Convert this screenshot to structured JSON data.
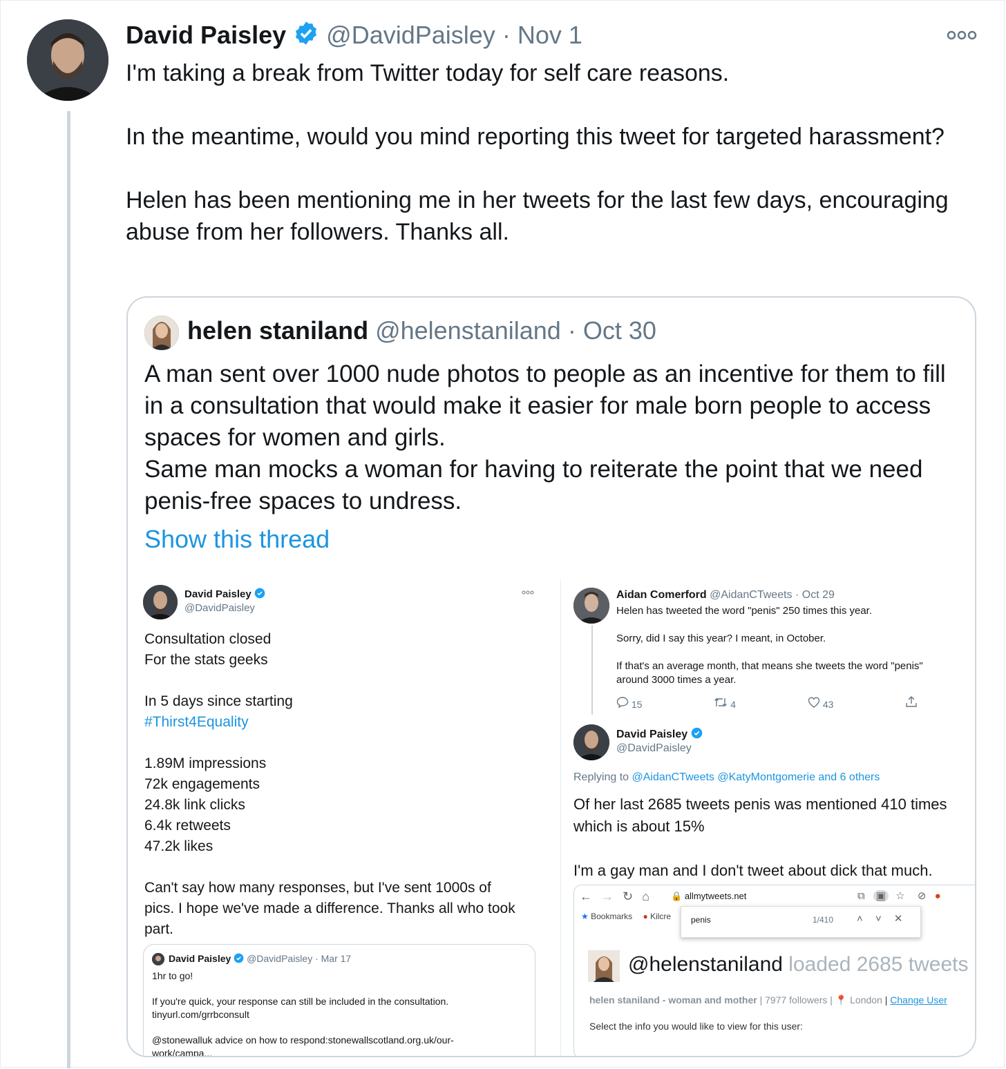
{
  "main_tweet": {
    "author_name": "David Paisley",
    "handle": "@DavidPaisley",
    "separator": "·",
    "date": "Nov 1",
    "text": "I'm taking a break from Twitter today for self care reasons.\n\nIn the meantime, would you mind reporting this tweet for targeted harassment?\n\nHelen has been mentioning me in her tweets for the last few days, encouraging abuse from her followers. Thanks all.",
    "more_icon": "more-horizontal-icon"
  },
  "quoted_tweet": {
    "author_name": "helen staniland",
    "handle": "@helenstaniland",
    "separator": "·",
    "date": "Oct 30",
    "text": "A man sent over 1000 nude photos to people as an incentive for them to fill in a consultation that would make it easier for male born people to access spaces for women and girls.\nSame man mocks a woman for having to reiterate the point that we need penis-free spaces to undress.",
    "show_thread": "Show this thread"
  },
  "left_screenshot": {
    "author_name": "David Paisley",
    "handle": "@DavidPaisley",
    "lines": [
      "Consultation closed",
      "For the stats geeks",
      "",
      "In 5 days since starting"
    ],
    "hashtag": "#Thirst4Equality",
    "stats": [
      "1.89M impressions",
      "72k engagements",
      "24.8k link clicks",
      "6.4k retweets",
      "47.2k likes"
    ],
    "closing": [
      "Can't say how many responses, but I've sent 1000s of",
      "pics. I hope we've made a difference. Thanks all who took",
      "part."
    ],
    "inner_tweet": {
      "author_name": "David Paisley",
      "handle": "@DavidPaisley",
      "date": "· Mar 17",
      "line1": "1hr to go!",
      "line2": "If you're quick, your response can still be included in the consultation.",
      "line3": "tinyurl.com/grrbconsult",
      "line4": "@stonewalluk advice on how to respond:stonewallscotland.org.uk/our-",
      "line5": "work/campa..."
    }
  },
  "right_screenshot": {
    "reply_author": "Aidan Comerford",
    "reply_handle": "@AidanCTweets",
    "reply_date": "· Oct 29",
    "reply_lines": [
      "Helen has tweeted the word \"penis\" 250 times this year.",
      "Sorry, did I say this year? I meant, in October.",
      "If that's an average month, that means she tweets the word \"penis\"",
      "around 3000 times a year."
    ],
    "counts": {
      "replies": "15",
      "retweets": "4",
      "likes": "43"
    },
    "author_name": "David Paisley",
    "handle": "@DavidPaisley",
    "replying_prefix": "Replying to",
    "replying_to": "@AidanCTweets @KatyMontgomerie and 6 others",
    "body_lines": [
      "Of her last 2685 tweets penis was mentioned 410 times",
      "which is about 15%",
      "I'm a gay man and I don't tweet about dick that much."
    ],
    "browser": {
      "url": "allmytweets.net",
      "bookmarks": "Bookmarks",
      "bookmark2": "Kilcre",
      "find_query": "penis",
      "find_count": "1/410",
      "overflow": "»",
      "heading_handle": "@helenstaniland",
      "heading_loaded": "loaded 2685 tweets",
      "info_line": "helen staniland - woman and mother",
      "followers": "| 7977 followers |",
      "location": "London",
      "change_user": "Change User",
      "select_prompt": "Select the info you would like to view for this user:"
    }
  },
  "colors": {
    "link": "#1b95e0",
    "muted": "#657786",
    "text": "#14171a",
    "border": "#ccd6dd",
    "verified": "#1da1f2"
  }
}
